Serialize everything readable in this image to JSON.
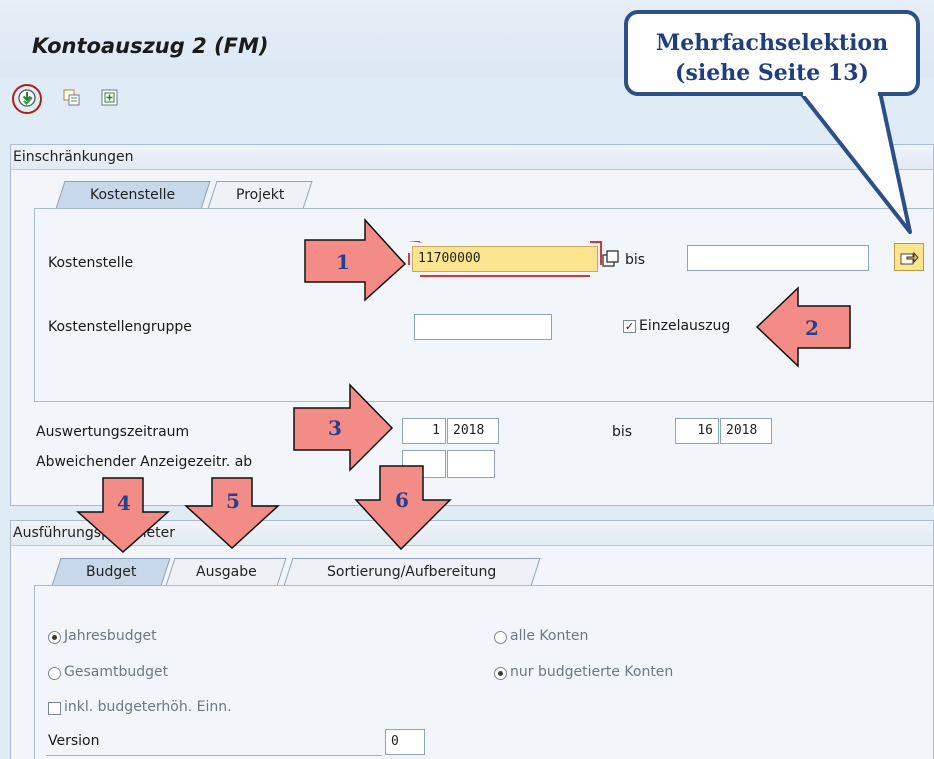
{
  "window": {
    "title": "Kontoauszug 2 (FM)"
  },
  "toolbar": {
    "icons": [
      "execute-icon",
      "copy-selection-icon",
      "add-selection-icon"
    ]
  },
  "callout": {
    "line1": "Mehrfachselektion",
    "line2": "(siehe Seite 13)"
  },
  "einschraenkungen": {
    "header": "Einschränkungen",
    "tabs": [
      {
        "label": "Kostenstelle"
      },
      {
        "label": "Projekt"
      }
    ],
    "kostenstelle": {
      "label": "Kostenstelle",
      "value": "11700000",
      "bis": "bis",
      "bis_value": ""
    },
    "gruppe": {
      "label": "Kostenstellengruppe",
      "value": ""
    },
    "einzelauszug": {
      "label": "Einzelauszug",
      "checked": true
    }
  },
  "zeitraum": {
    "label": "Auswertungszeitraum",
    "from_period": "1",
    "from_year": "2018",
    "bis": "bis",
    "to_period": "16",
    "to_year": "2018"
  },
  "abweichender": {
    "label": "Abweichender Anzeigezeitr. ab",
    "period": "",
    "year": ""
  },
  "ausfuehrung": {
    "header": "Ausführungsparameter",
    "tabs": [
      {
        "label": "Budget"
      },
      {
        "label": "Ausgabe"
      },
      {
        "label": "Sortierung/Aufbereitung"
      }
    ],
    "jahresbudget": "Jahresbudget",
    "gesamtbudget": "Gesamtbudget",
    "inkl": "inkl. budgeterhöh. Einn.",
    "alle_konten": "alle Konten",
    "nur_budgetiert": "nur budgetierte Konten",
    "version_label": "Version",
    "version_value": "0"
  },
  "annotations": {
    "a1": "1",
    "a2": "2",
    "a3": "3",
    "a4": "4",
    "a5": "5",
    "a6": "6"
  }
}
